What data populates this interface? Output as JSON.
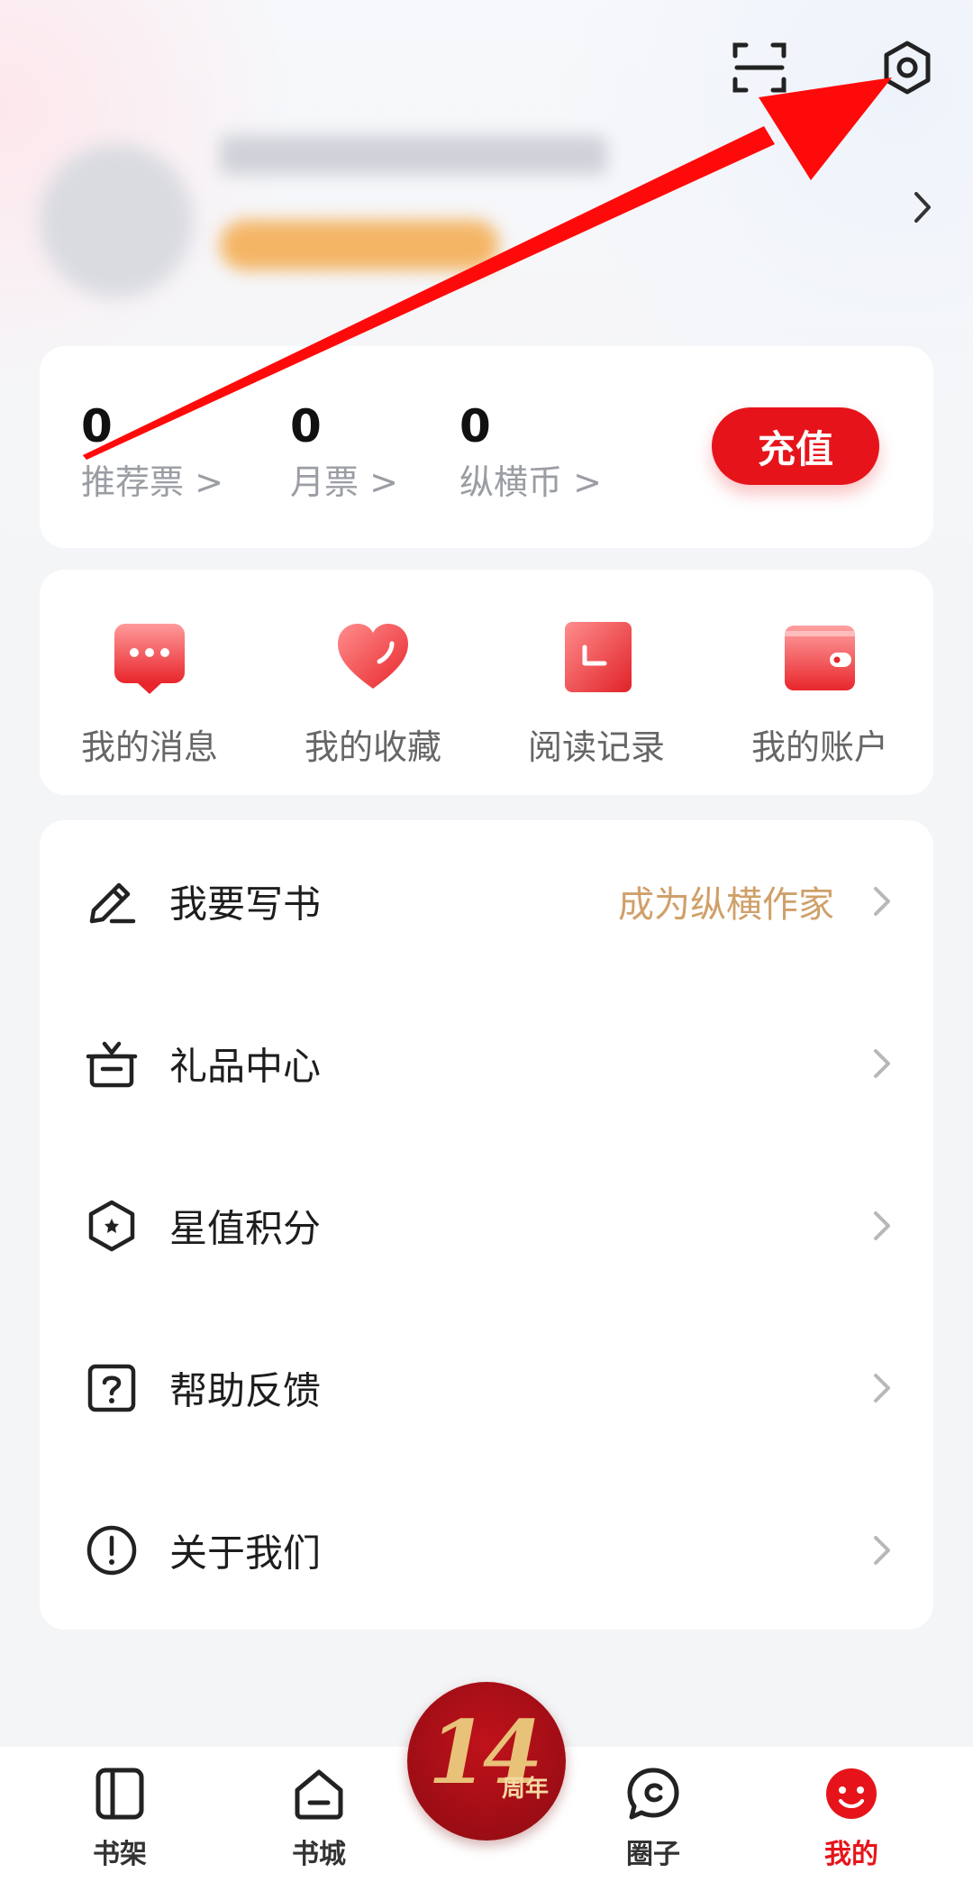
{
  "header": {
    "scan_icon": "scan-icon",
    "settings_icon": "settings-icon"
  },
  "stats": [
    {
      "value": "0",
      "label": "推荐票 >"
    },
    {
      "value": "0",
      "label": "月票 >"
    },
    {
      "value": "0",
      "label": "纵横币 >"
    }
  ],
  "recharge_label": "充值",
  "quick_actions": [
    {
      "label": "我的消息",
      "icon": "message-icon"
    },
    {
      "label": "我的收藏",
      "icon": "heart-icon"
    },
    {
      "label": "阅读记录",
      "icon": "history-icon"
    },
    {
      "label": "我的账户",
      "icon": "wallet-icon"
    }
  ],
  "menu": [
    {
      "label": "我要写书",
      "extra": "成为纵横作家",
      "icon": "pencil-icon"
    },
    {
      "label": "礼品中心",
      "extra": "",
      "icon": "gift-icon"
    },
    {
      "label": "星值积分",
      "extra": "",
      "icon": "star-hexagon-icon"
    },
    {
      "label": "帮助反馈",
      "extra": "",
      "icon": "help-icon"
    },
    {
      "label": "关于我们",
      "extra": "",
      "icon": "info-icon"
    }
  ],
  "tabs": [
    {
      "label": "书架",
      "icon": "bookshelf-icon"
    },
    {
      "label": "书城",
      "icon": "store-icon"
    },
    {
      "label": "圈子",
      "icon": "community-icon"
    },
    {
      "label": "我的",
      "icon": "profile-icon"
    }
  ],
  "center_badge": {
    "number": "14",
    "text": "周年"
  },
  "colors": {
    "accent": "#e6141a",
    "author_link": "#d0a06a",
    "background": "#f4f5f7"
  }
}
